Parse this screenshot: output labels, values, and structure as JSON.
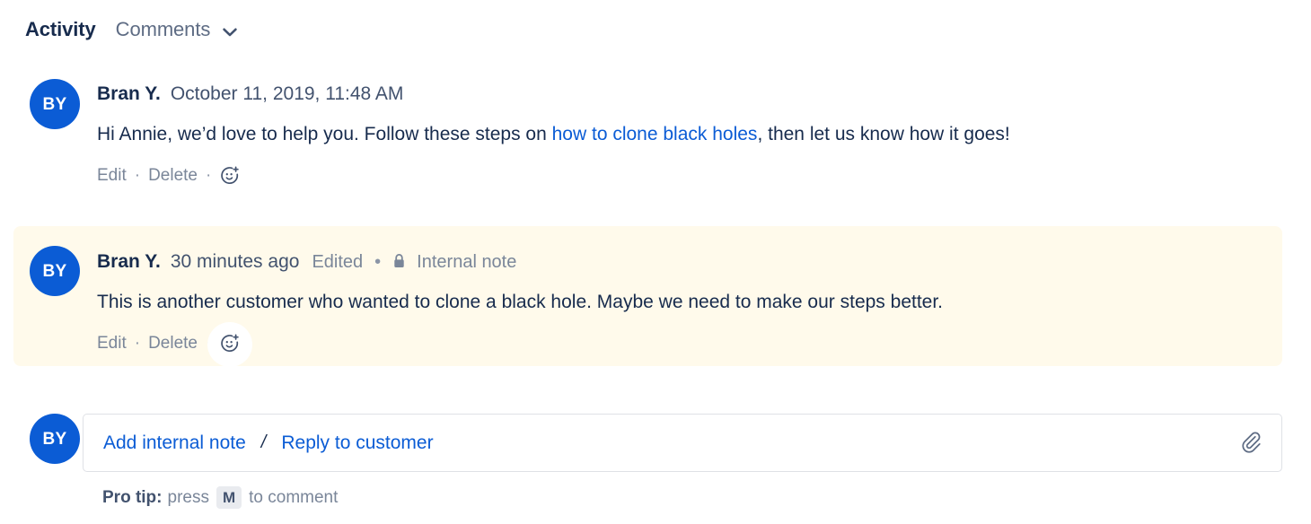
{
  "header": {
    "tabs": [
      {
        "label": "Activity",
        "active": true
      },
      {
        "label": "Comments",
        "active": false
      }
    ],
    "dropdown_icon": "chevron-down-icon"
  },
  "comments": [
    {
      "id": "comment-public",
      "avatar_initials": "BY",
      "author": "Bran Y.",
      "timestamp": "October 11, 2019, 11:48 AM",
      "edited_label": "",
      "visibility_label": "",
      "internal": false,
      "text_before_link": "Hi Annie, we’d love to help you. Follow these steps on ",
      "link_text": "how to clone black holes",
      "text_after_link": ", then let us know how it goes!",
      "actions": {
        "edit": "Edit",
        "separator": "·",
        "delete": "Delete",
        "emoji_icon": "add-reaction-icon",
        "emoji_hovered": false
      }
    },
    {
      "id": "comment-internal",
      "avatar_initials": "BY",
      "author": "Bran Y.",
      "timestamp": "30 minutes ago",
      "edited_label": "Edited",
      "bullet": "•",
      "lock_icon": "lock-icon",
      "visibility_label": "Internal note",
      "internal": true,
      "text_before_link": "This is another customer who wanted to clone a black hole. Maybe we need to make our steps better.",
      "link_text": "",
      "text_after_link": "",
      "actions": {
        "edit": "Edit",
        "separator": "·",
        "delete": "Delete",
        "emoji_icon": "add-reaction-icon",
        "emoji_hovered": true
      }
    }
  ],
  "composer": {
    "avatar_initials": "BY",
    "add_internal_note": "Add internal note",
    "divider": "/",
    "reply_to_customer": "Reply to customer",
    "attachment_icon": "paperclip-icon"
  },
  "protip": {
    "label": "Pro tip:",
    "press_word": "press",
    "key": "M",
    "suffix": "to comment"
  },
  "colors": {
    "accent_blue": "#0B5CD5",
    "text_dark": "#172B4D",
    "text_muted": "#7A8699",
    "internal_note_bg": "#FFFAEB",
    "border": "#DFE1E6",
    "key_badge_bg": "#E9EBEF"
  }
}
